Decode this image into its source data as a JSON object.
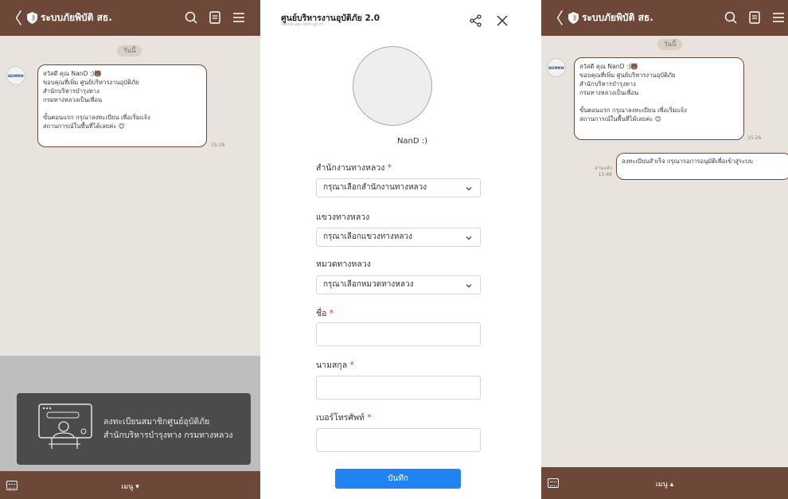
{
  "chat": {
    "title": "ระบบภัยพิบัติ สธ.",
    "date_label": "วันนี้",
    "avatar_text": "BEIMMW",
    "welcome_message": "สวัสดี คุณ NanD :)🐻\nขอบคุณที่เพิ่ม ศูนย์บริหารงานอุบัติภัย\nสำนักบริหารบำรุงทาง\nกรมทางหลวงเป็นเพื่อน\n\nขั้นตอนแรก กรุณาลงทะเบียน เพื่อเริ่มแจ้ง\nสถานการณ์ในพื้นที่ได้เลยค่ะ 😊",
    "welcome_time_left": "15:28",
    "welcome_time_right": "15:26",
    "reply_message": "ลงทะเบียนสำเร็จ กรุณารอการอนุมัติเพื่อเข้าสู่ระบบ",
    "reply_read_label": "อ่านแล้ว",
    "reply_time": "15:46",
    "menu_label_left": "เมนู ▾",
    "menu_label_right": "เมนู ▴",
    "rich_menu_line1": "ลงทะเบียนสมาชิกศูนย์อุบัติภัย",
    "rich_menu_line2": "สำนักบริหารบำรุงทาง กรมทางหลวง",
    "rich_menu_icon_text": "REGISTRATION"
  },
  "form": {
    "title": "ศูนย์บริหารงานอุบัติภัย 2.0",
    "subtitle": "home.api.doh.go.th",
    "user_name": "NanD :)",
    "office_label": "สำนักงานทางหลวง",
    "office_placeholder": "กรุณาเลือกสำนักงานทางหลวง",
    "district_label": "แขวงทางหลวง",
    "district_placeholder": "กรุณาเลือกแขวงทางหลวง",
    "unit_label": "หมวดทางหลวง",
    "unit_placeholder": "กรุณาเลือกหมวดทางหลวง",
    "firstname_label": "ชื่อ",
    "lastname_label": "นามสกุล",
    "phone_label": "เบอร์โทรศัพท์",
    "required_mark": "*",
    "save_label": "บันทึก"
  },
  "colors": {
    "brand_brown": "#6d4838",
    "chat_bg": "#e9e3dd",
    "primary_blue": "#1f84f2",
    "required_red": "#d9304a"
  },
  "icons": [
    "back-icon",
    "shield-icon",
    "search-icon",
    "notes-icon",
    "menu-icon",
    "keyboard-icon",
    "share-icon",
    "close-icon",
    "chevron-down-icon",
    "registration-icon"
  ]
}
